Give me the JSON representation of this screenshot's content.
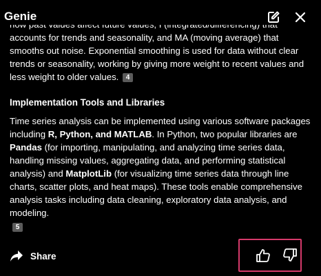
{
  "header": {
    "title": "Genie"
  },
  "content": {
    "clipped_line": "how past values affect future values, I (integrated/differencing) that",
    "para1": "accounts for trends and seasonality, and MA (moving average) that smooths out noise. Exponential smoothing is used for data without clear trends or seasonality, working by giving more weight to recent values and less weight to older values.",
    "cite1": "4",
    "section_title": "Implementation Tools and Libraries",
    "para2": {
      "t1": "Time series analysis can be implemented using various software packages including ",
      "b1": "R, Python, and MATLAB",
      "t2": ". In Python, two popular libraries are ",
      "b2": "Pandas",
      "t3": " (for importing, manipulating, and analyzing time series data, handling missing values, aggregating data, and performing statistical analysis) and ",
      "b3": "MatplotLib",
      "t4": " (for visualizing time series data through line charts, scatter plots, and heat maps). These tools enable comprehensive analysis tasks including data cleaning, exploratory data analysis, and modeling."
    },
    "cite2": "5"
  },
  "footer": {
    "share_label": "Share"
  },
  "colors": {
    "background": "#000000",
    "text": "#ffffff",
    "citation_badge": "#5b5b5b",
    "feedback_highlight": "#d63a6b"
  },
  "icons": {
    "edit": "edit-icon",
    "close": "close-icon",
    "share": "share-icon",
    "thumbs_up": "thumbs-up-icon",
    "thumbs_down": "thumbs-down-icon"
  }
}
